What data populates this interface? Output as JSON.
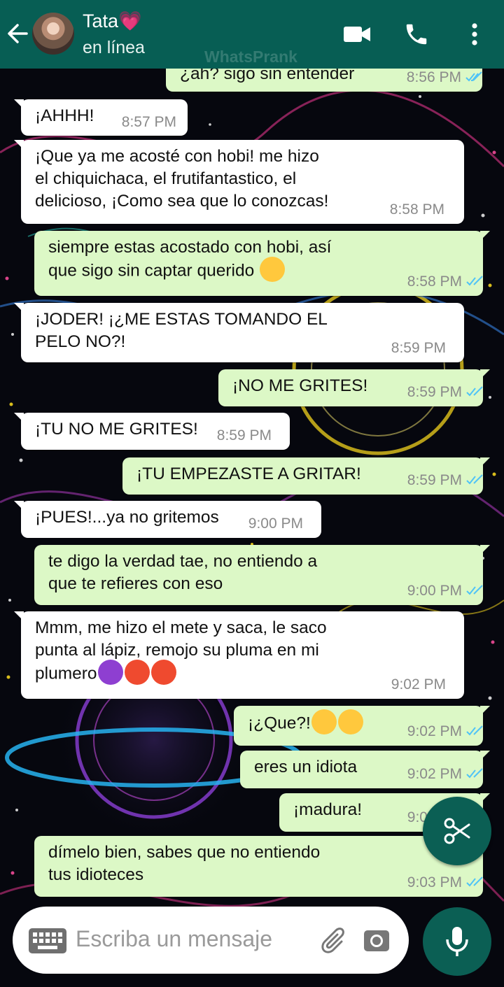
{
  "header": {
    "contact_name": "Tata💗",
    "status": "en línea",
    "watermark": "WhatsPrank"
  },
  "messages": [
    {
      "dir": "out",
      "lines": [
        "¿ah? sigo sin entender"
      ],
      "time": "8:56 PM",
      "read": true
    },
    {
      "dir": "in",
      "lines": [
        "¡AHHH!"
      ],
      "time": "8:57 PM"
    },
    {
      "dir": "in",
      "lines": [
        "¡Que ya me acosté con hobi! me hizo",
        "el chiquichaca, el frutifantastico, el",
        "delicioso, ¡Como sea que lo conozcas!"
      ],
      "time": "8:58 PM"
    },
    {
      "dir": "out",
      "lines": [
        "siempre estas acostado con hobi, así",
        "que sigo sin captar querido"
      ],
      "emoji": "face-with-hand-over-mouth",
      "time": "8:58 PM",
      "read": true
    },
    {
      "dir": "in",
      "lines": [
        "¡JODER! ¡¿ME ESTAS TOMANDO EL",
        "PELO NO?!"
      ],
      "time": "8:59 PM"
    },
    {
      "dir": "out",
      "lines": [
        "¡NO ME GRITES!"
      ],
      "time": "8:59 PM",
      "read": true
    },
    {
      "dir": "in",
      "lines": [
        "¡TU NO ME GRITES!"
      ],
      "time": "8:59 PM"
    },
    {
      "dir": "out",
      "lines": [
        "¡TU EMPEZASTE A GRITAR!"
      ],
      "time": "8:59 PM",
      "read": true
    },
    {
      "dir": "in",
      "lines": [
        "¡PUES!...ya no gritemos"
      ],
      "time": "9:00 PM"
    },
    {
      "dir": "out",
      "lines": [
        "te digo la verdad tae, no entiendo a",
        "que te refieres con eso"
      ],
      "time": "9:00 PM",
      "read": true
    },
    {
      "dir": "in",
      "lines": [
        "Mmm, me hizo el mete y saca, le saco",
        "punta al lápiz, remojo su pluma en mi",
        "plumero"
      ],
      "emoji": "smiling-devil, hot-face, hot-face",
      "time": "9:02 PM"
    },
    {
      "dir": "out",
      "lines": [
        "¡¿Que?!"
      ],
      "emoji": "rofl, rofl",
      "time": "9:02 PM",
      "read": true
    },
    {
      "dir": "out",
      "lines": [
        "eres un idiota"
      ],
      "time": "9:02 PM",
      "read": true
    },
    {
      "dir": "out",
      "lines": [
        "¡madura!"
      ],
      "time": "9:02 PM",
      "read": true
    },
    {
      "dir": "out",
      "lines": [
        "dímelo bien, sabes que no entiendo",
        "tus idioteces"
      ],
      "time": "9:03 PM",
      "read": true
    }
  ],
  "input": {
    "placeholder": "Escriba un mensaje"
  },
  "icons": {
    "back": "arrow-left-icon",
    "video": "video-call-icon",
    "call": "phone-icon",
    "menu": "more-vert-icon",
    "keyboard": "keyboard-icon",
    "attach": "paperclip-icon",
    "camera": "camera-icon",
    "mic": "microphone-icon",
    "scissors": "scissors-icon"
  },
  "colors": {
    "header": "#075e54",
    "outgoing_bubble": "#dcf8c6",
    "incoming_bubble": "#ffffff",
    "read_ticks": "#4fc3f7",
    "fab": "#0b5f54"
  }
}
